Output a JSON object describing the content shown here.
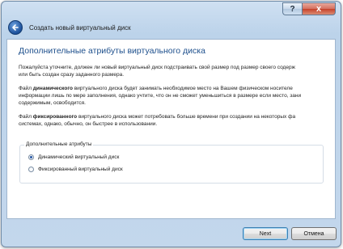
{
  "window": {
    "help_label": "?",
    "close_label": "x"
  },
  "header": {
    "title": "Создать новый виртуальный диск"
  },
  "content": {
    "heading": "Дополнительные атрибуты виртуального диска",
    "intro": [
      "Пожалуйста уточните, должен ли новый виртуальный диск подстраивать свой размер под размер своего содерж",
      "или быть создан сразу заданного размера."
    ],
    "dynamic": {
      "prefix": "Файл ",
      "bold": "динамического",
      "line1_rest": " виртуального диска будет занимать необходимое место на Вашем физическом носителе",
      "line2": "информации лишь по мере заполнения, однако учтите, что он не сможет уменьшиться в размере если место, зани",
      "line3": "содержимым, освободится."
    },
    "fixed": {
      "prefix": "Файл ",
      "bold": "фиксированного",
      "line1_rest": " виртуального диска может потребовать больше времени при создании на некоторых фа",
      "line2": "системах, однако, обычно, он быстрее в использовании."
    },
    "group": {
      "legend": "Дополнительные атрибуты",
      "options": [
        {
          "label": "Динамический виртуальный диск",
          "checked": true
        },
        {
          "label": "Фиксированный виртуальный диск",
          "checked": false
        }
      ]
    }
  },
  "footer": {
    "next_label": "Next",
    "cancel_label": "Отмена"
  }
}
